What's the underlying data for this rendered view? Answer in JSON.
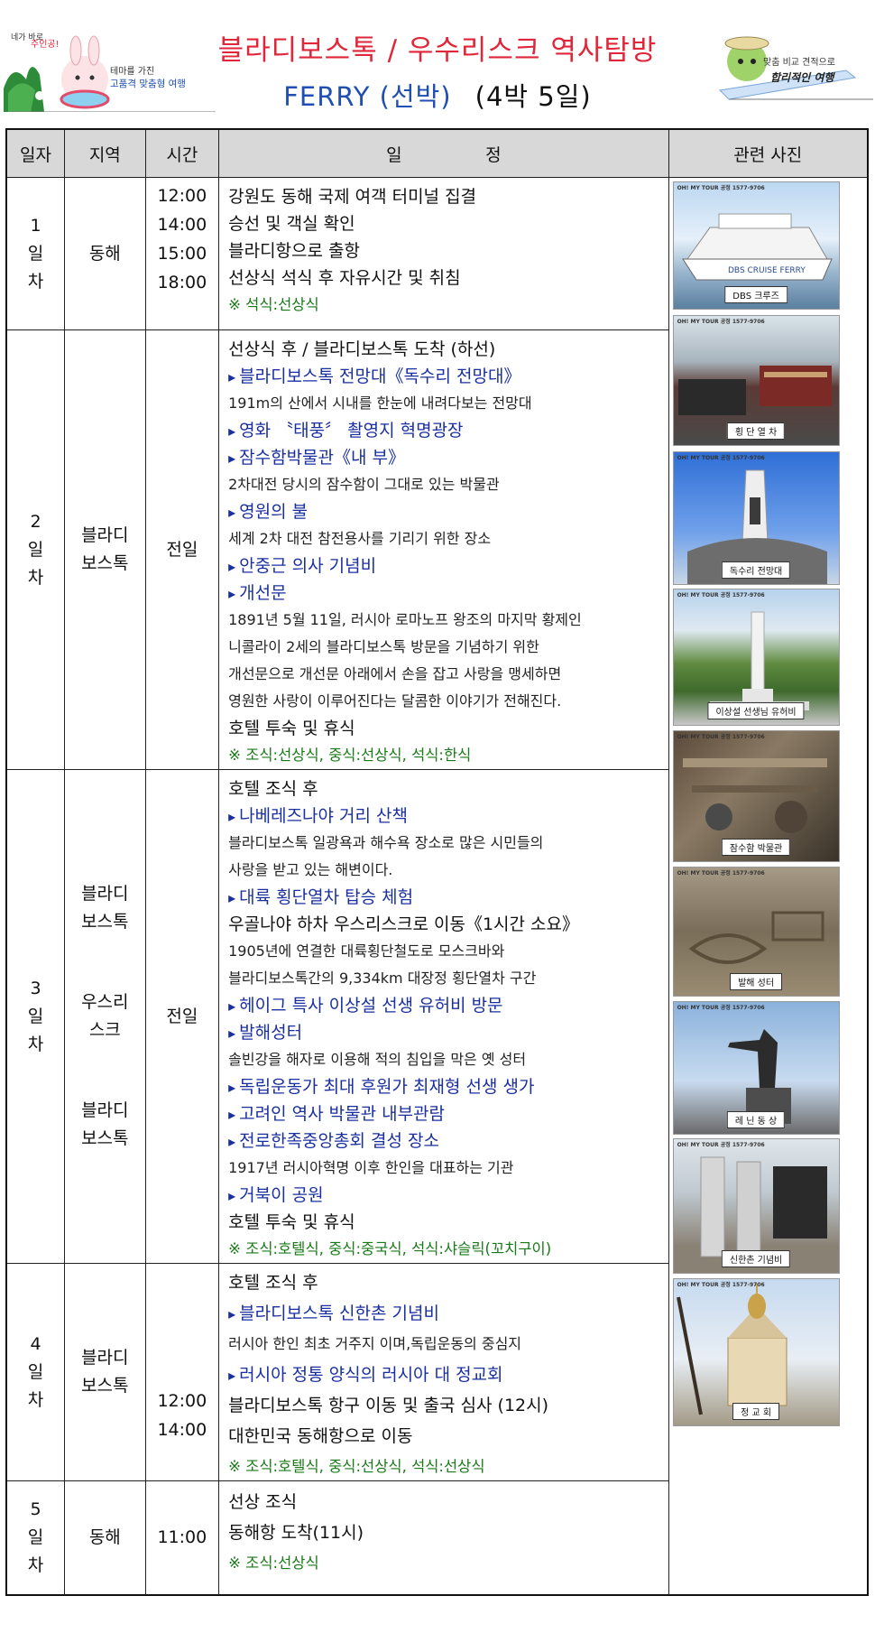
{
  "header": {
    "title_line1": "블라디보스톡 / 우수리스크 역사탐방",
    "title_line2_a": "FERRY (선박)",
    "title_line2_b": "(4박 5일)",
    "logo_left_top": "네가 바로 여행의 주인공!",
    "logo_left_sub1": "테마를 가진",
    "logo_left_sub2": "고품격 맞춤형 여행",
    "logo_right_sub1": "맞춤 비교 견적으로",
    "logo_right_sub2": "합리적인 여행"
  },
  "columns": [
    "일자",
    "지역",
    "시간",
    "일 정",
    "관련 사진"
  ],
  "plan_header_a": "일",
  "plan_header_b": "정",
  "days": [
    {
      "day": [
        "1",
        "일",
        "차"
      ],
      "region": [
        "동해"
      ],
      "times": [
        "12:00",
        "14:00",
        "15:00",
        "18:00"
      ],
      "lines": [
        {
          "t": "강원도 동해 국제 여객 터미널 집결",
          "k": "main"
        },
        {
          "t": "승선 및 객실 확인",
          "k": "main"
        },
        {
          "t": "블라디항으로 출항",
          "k": "main"
        },
        {
          "t": "선상식 석식 후 자유시간 및 취침",
          "k": "main"
        },
        {
          "t": "※ 석식:선상식",
          "k": "green"
        }
      ]
    },
    {
      "day": [
        "2",
        "일",
        "차"
      ],
      "region": [
        "블라디",
        "보스톡"
      ],
      "times": [
        "전일"
      ],
      "lines": [
        {
          "t": "선상식 후 / 블라디보스톡 도착 (하선)",
          "k": "main"
        },
        {
          "t": "블라디보스톡 전망대《독수리 전망대》",
          "k": "blue"
        },
        {
          "t": "191m의 산에서 시내를 한눈에 내려다보는 전망대",
          "k": "sub"
        },
        {
          "t": "영화 〝태풍〞 촬영지 혁명광장",
          "k": "blue"
        },
        {
          "t": "잠수함박물관《내 부》",
          "k": "blue"
        },
        {
          "t": "2차대전 당시의 잠수함이 그대로 있는 박물관",
          "k": "sub"
        },
        {
          "t": "영원의 불",
          "k": "blue"
        },
        {
          "t": "세계 2차 대전 참전용사를 기리기 위한 장소",
          "k": "sub"
        },
        {
          "t": "안중근 의사 기념비",
          "k": "blue"
        },
        {
          "t": "개선문",
          "k": "blue"
        },
        {
          "t": "1891년 5월 11일, 러시아 로마노프 왕조의 마지막 황제인",
          "k": "sub"
        },
        {
          "t": "니콜라이 2세의 블라디보스톡 방문을 기념하기 위한",
          "k": "sub"
        },
        {
          "t": "개선문으로 개선문 아래에서 손을 잡고 사랑을 맹세하면",
          "k": "sub"
        },
        {
          "t": "영원한 사랑이 이루어진다는 달콤한 이야기가 전해진다.",
          "k": "sub"
        },
        {
          "t": "호텔 투숙 및 휴식",
          "k": "main"
        },
        {
          "t": "※ 조식:선상식, 중식:선상식, 석식:한식",
          "k": "green"
        }
      ]
    },
    {
      "day": [
        "3",
        "일",
        "차"
      ],
      "region_a": [
        "블라디",
        "보스톡"
      ],
      "region_b": [
        "우스리",
        "스크"
      ],
      "region_c": [
        "블라디",
        "보스톡"
      ],
      "times": [
        "전일"
      ],
      "lines": [
        {
          "t": "호텔 조식 후",
          "k": "main"
        },
        {
          "t": "나베레즈나야 거리 산책",
          "k": "blue"
        },
        {
          "t": "블라디보스톡 일광욕과 해수욕 장소로 많은 시민들의",
          "k": "sub"
        },
        {
          "t": "사랑을 받고 있는 해변이다.",
          "k": "sub"
        },
        {
          "t": "대륙 횡단열차 탑승 체험",
          "k": "blue"
        },
        {
          "t": "우골나야 하차 우스리스크로 이동《1시간 소요》",
          "k": "main"
        },
        {
          "t": "1905년에 연결한 대륙횡단철도로 모스크바와",
          "k": "sub"
        },
        {
          "t": "블라디보스톡간의 9,334km 대장정 횡단열차 구간",
          "k": "sub"
        },
        {
          "t": "헤이그 특사 이상설 선생 유허비 방문",
          "k": "blue"
        },
        {
          "t": "발해성터",
          "k": "blue"
        },
        {
          "t": "솔빈강을 해자로 이용해 적의 침입을 막은 옛 성터",
          "k": "sub"
        },
        {
          "t": "독립운동가 최대 후원가 최재형 선생 생가",
          "k": "blue"
        },
        {
          "t": "고려인 역사 박물관 내부관람",
          "k": "blue"
        },
        {
          "t": "전로한족중앙총회 결성 장소",
          "k": "blue"
        },
        {
          "t": "1917년 러시아혁명 이후 한인을 대표하는 기관",
          "k": "sub"
        },
        {
          "t": "거북이 공원",
          "k": "blue"
        },
        {
          "t": "호텔 투숙 및 휴식",
          "k": "main"
        },
        {
          "t": "※ 조식:호텔식, 중식:중국식, 석식:샤슬릭(꼬치구이)",
          "k": "green"
        }
      ]
    },
    {
      "day": [
        "4",
        "일",
        "차"
      ],
      "region": [
        "블라디",
        "보스톡"
      ],
      "times": [
        "12:00",
        "14:00"
      ],
      "lines": [
        {
          "t": "호텔 조식 후",
          "k": "main"
        },
        {
          "t": "블라디보스톡 신한촌 기념비",
          "k": "blue"
        },
        {
          "t": "러시아 한인 최초 거주지 이며,독립운동의 중심지",
          "k": "sub"
        },
        {
          "t": "러시아 정통 양식의 러시아 대 정교회",
          "k": "blue"
        },
        {
          "t": "블라디보스톡 항구 이동 및 출국 심사 (12시)",
          "k": "main"
        },
        {
          "t": "대한민국 동해항으로 이동",
          "k": "main"
        },
        {
          "t": "※ 조식:호텔식, 중식:선상식, 석식:선상식",
          "k": "green"
        }
      ]
    },
    {
      "day": [
        "5",
        "일",
        "차"
      ],
      "region": [
        "동해"
      ],
      "times": [
        "11:00"
      ],
      "lines": [
        {
          "t": "선상 조식",
          "k": "main"
        },
        {
          "t": "동해항 도착(11시)",
          "k": "main"
        },
        {
          "t": "※ 조식:선상식",
          "k": "green"
        }
      ]
    }
  ],
  "photos": {
    "tag": "OH! MY TOUR 공정 1577-9706",
    "captions": [
      "DBS 크루즈",
      "횡 단 열 차",
      "독수리 전망대",
      "이상설 선생님 유허비",
      "잠수함 박물관",
      "발해 성터",
      "레 닌 동 상",
      "신한촌 기념비",
      "정 교 회"
    ]
  }
}
